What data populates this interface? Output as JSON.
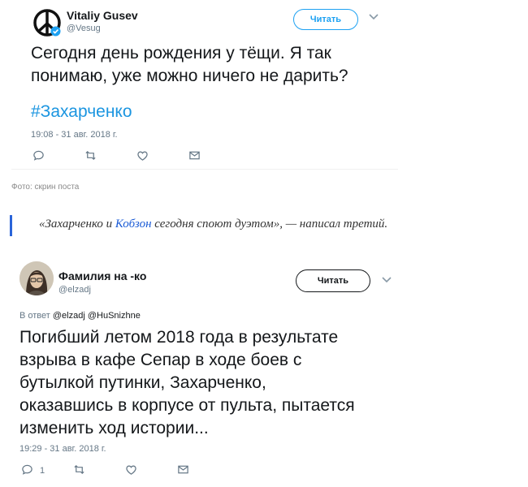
{
  "tweet1": {
    "author_name": "Vitaliy Gusev",
    "author_handle": "@Vesug",
    "follow_label": "Читать",
    "text_line1": "Сегодня день рождения у тёщи. Я так",
    "text_line2": "понимаю, уже можно ничего не дарить?",
    "hashtag": "#Захарченко",
    "timestamp": "19:08 - 31 авг. 2018 г."
  },
  "caption": "Фото: скрин поста",
  "quote": {
    "before": "«Захарченко и ",
    "link": "Кобзон",
    "after": " сегодня споют дуэтом», — написал третий."
  },
  "tweet2": {
    "author_name": "Фамилия на -ко",
    "author_handle": "@elzadj",
    "follow_label": "Читать",
    "replying_prefix": "В ответ",
    "replying_users": "@elzadj @HuSnizhne",
    "text_lines": [
      "Погибший летом 2018 года в результате",
      "взрыва в кафе Сепар в ходе боев с",
      "бутылкой путинки, Захарченко,",
      "оказавшись в корпусе от пульта, пытается",
      "изменить ход истории..."
    ],
    "timestamp": "19:29 - 31 авг. 2018 г.",
    "reply_count": "1"
  },
  "icons": [
    "peace-sign-avatar",
    "verified-badge-icon",
    "chevron-down-icon",
    "reply-icon",
    "retweet-icon",
    "like-icon",
    "dm-icon"
  ],
  "colors": {
    "accent": "#1da1f2",
    "hashtag": "#1b95e0",
    "quote_bar": "#2a64d9",
    "quote_link": "#1a5bd6"
  }
}
